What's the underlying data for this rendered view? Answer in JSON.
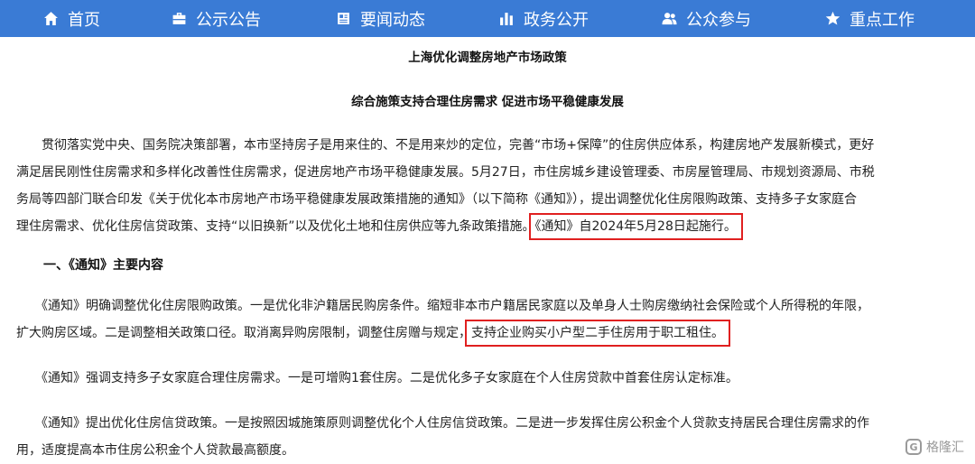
{
  "nav": {
    "items": [
      {
        "label": "首页",
        "icon": "home-icon"
      },
      {
        "label": "公示公告",
        "icon": "briefcase-icon"
      },
      {
        "label": "要闻动态",
        "icon": "newspaper-icon"
      },
      {
        "label": "政务公开",
        "icon": "bar-chart-icon"
      },
      {
        "label": "公众参与",
        "icon": "users-icon"
      },
      {
        "label": "重点工作",
        "icon": "star-icon"
      }
    ],
    "background_color": "#3a7bd5"
  },
  "article": {
    "title": "上海优化调整房地产市场政策",
    "subtitle": "综合施策支持合理住房需求 促进市场平稳健康发展",
    "intro_lines": [
      "　　贯彻落实党中央、国务院决策部署，本市坚持房子是用来住的、不是用来炒的定位，完善“市场+保障”的住房供应体系，构建房地产发展新模式，更好",
      "满足居民刚性住房需求和多样化改善性住房需求，促进房地产市场平稳健康发展。5月27日，市住房城乡建设管理委、市房屋管理局、市规划资源局、市税",
      "务局等四部门联合印发《关于优化本市房地产市场平稳健康发展政策措施的通知》（以下简称《通知》），提出调整优化住房限购政策、支持多子女家庭合",
      "理住房需求、优化住房信贷政策、支持“以旧换新”以及优化土地和住房供应等九条政策措施。"
    ],
    "intro_highlight": "《通知》自2024年5月28日起施行。",
    "section1_heading": "一、《通知》主要内容",
    "p1_lines": [
      "　　《通知》明确调整优化住房限购政策。一是优化非沪籍居民购房条件。缩短非本市户籍居民家庭以及单身人士购房缴纳社会保险或个人所得税的年限，",
      "扩大购房区域。二是调整相关政策口径。取消离异购房限制，调整住房赠与规定，"
    ],
    "p1_highlight": "支持企业购买小户型二手住房用于职工租住。",
    "p2": "　　《通知》强调支持多子女家庭合理住房需求。一是可增购1套住房。二是优化多子女家庭在个人住房贷款中首套住房认定标准。",
    "p3_lines": [
      "　　《通知》提出优化住房信贷政策。一是按照因城施策原则调整优化个人住房信贷政策。二是进一步发挥住房公积金个人贷款支持居民合理住房需求的作",
      "用，适度提高本市住房公积金个人贷款最高额度。"
    ],
    "highlight_color": "#e02020"
  },
  "watermark": {
    "logo": "G",
    "text": "格隆汇"
  }
}
